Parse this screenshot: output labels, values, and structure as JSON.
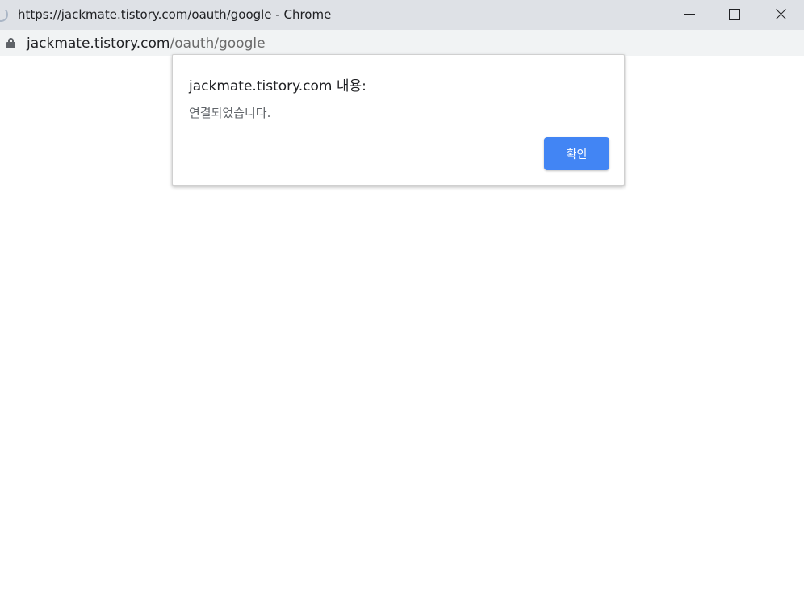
{
  "window": {
    "title": "https://jackmate.tistory.com/oauth/google - Chrome",
    "controls": [
      "minimize-icon",
      "maximize-icon",
      "close-icon"
    ]
  },
  "address_bar": {
    "icon": "lock-icon",
    "host": "jackmate.tistory.com",
    "path": "/oauth/google"
  },
  "dialog": {
    "title": "jackmate.tistory.com 내용:",
    "message": "연결되었습니다.",
    "ok_label": "확인",
    "button_color": "#4285f4"
  }
}
